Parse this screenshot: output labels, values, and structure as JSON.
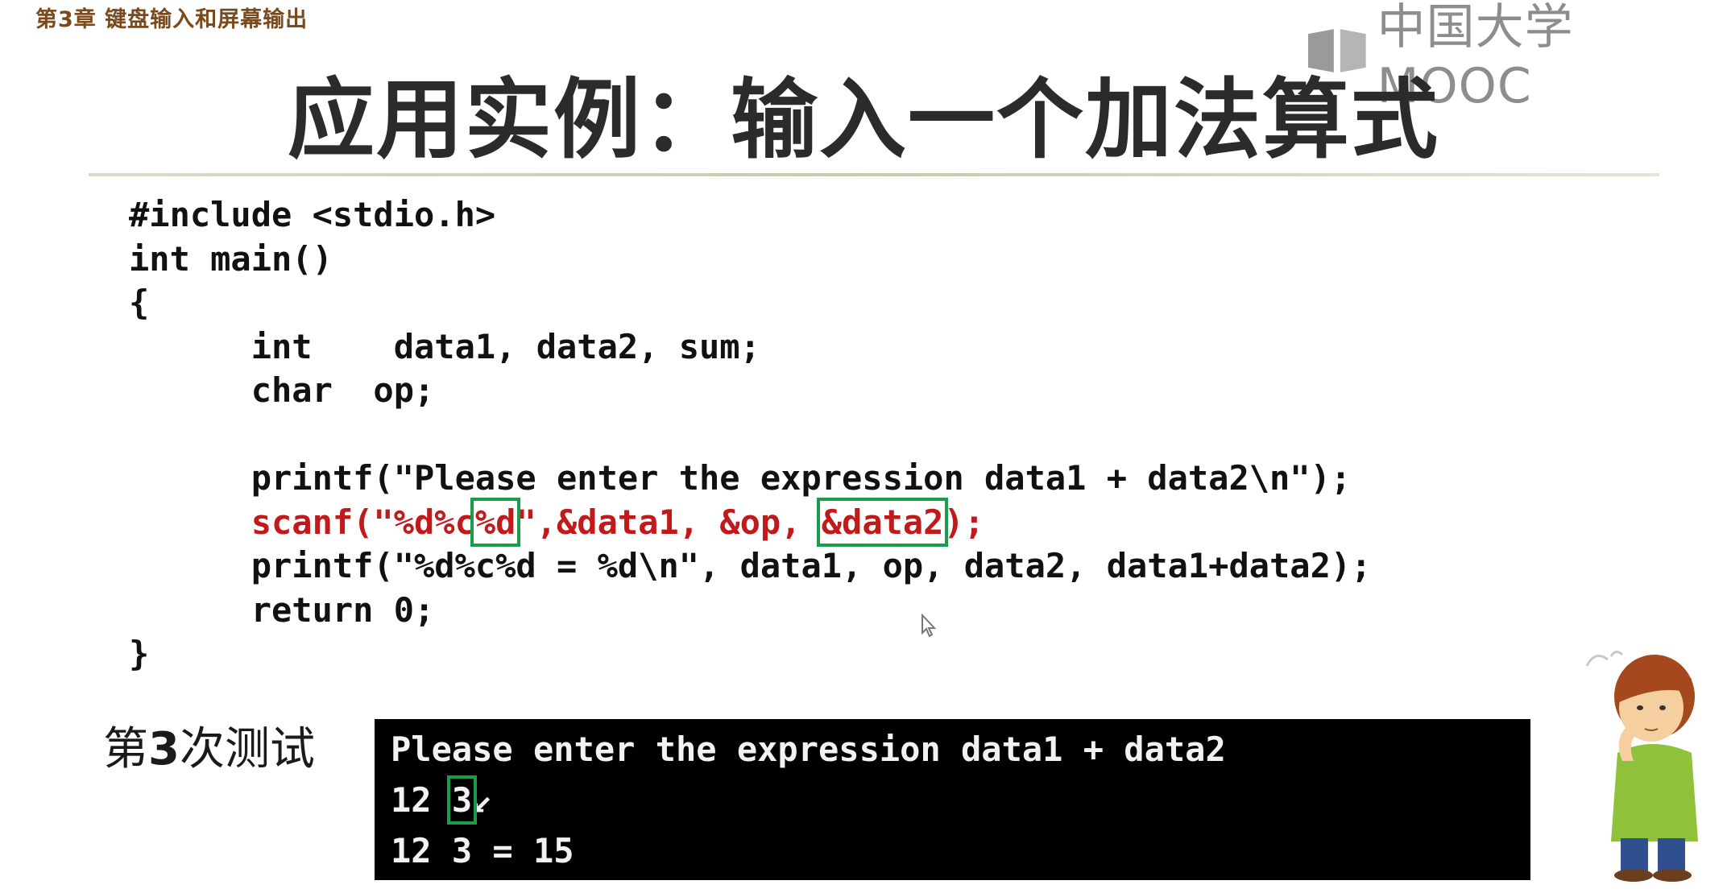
{
  "header": {
    "chapter": "第3章 键盘输入和屏幕输出",
    "brand": "中国大学MOOC",
    "title": "应用实例：输入一个加法算式"
  },
  "code": {
    "line1": "#include <stdio.h>",
    "line2": "int main()",
    "line3": "{",
    "line4": "      int    data1, data2, sum;",
    "line5": "      char  op;",
    "line6": "",
    "line7": "      printf(\"Please enter the expression data1 + data2\\n\");",
    "scanf_a": "      scanf(\"%d%c",
    "scanf_b": "%d",
    "scanf_c": "\",&data1, &op, ",
    "scanf_d": "&data2",
    "scanf_e": ");",
    "line9": "      printf(\"%d%c%d = %d\\n\", data1, op, data2, data1+data2);",
    "line10": "      return 0;",
    "line11": "}"
  },
  "test": {
    "label_prefix": "第",
    "label_num": "3",
    "label_suffix": "次测试"
  },
  "console": {
    "line1": "Please enter the expression data1 + data2",
    "line2_a": "12 ",
    "line2_b": "3",
    "line2_c": "↙",
    "line3": "12 3 = 15"
  },
  "colors": {
    "highlight_box": "#1a9c4e",
    "scanf_text": "#c21a1a",
    "console_bg": "#000000"
  }
}
